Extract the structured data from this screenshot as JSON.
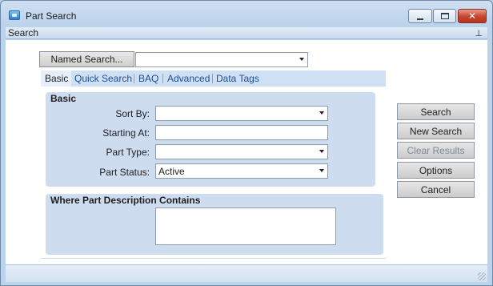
{
  "window": {
    "title": "Part Search",
    "close_glyph": "✕"
  },
  "panel": {
    "header": "Search",
    "pin_glyph": "⊥"
  },
  "named_search": {
    "button_label": "Named Search...",
    "value": ""
  },
  "tabs": [
    {
      "label": "Basic",
      "active": true
    },
    {
      "label": "Quick Search",
      "active": false
    },
    {
      "label": "BAQ",
      "active": false
    },
    {
      "label": "Advanced",
      "active": false
    },
    {
      "label": "Data Tags",
      "active": false
    }
  ],
  "basic_group": {
    "title": "Basic",
    "sort_by": {
      "label": "Sort By:",
      "value": ""
    },
    "starting_at": {
      "label": "Starting At:",
      "value": ""
    },
    "part_type": {
      "label": "Part Type:",
      "value": ""
    },
    "part_status": {
      "label": "Part Status:",
      "value": "Active"
    }
  },
  "where_group": {
    "title": "Where Part Description Contains",
    "value": ""
  },
  "actions": {
    "search": "Search",
    "new_search": "New Search",
    "clear_results": "Clear Results",
    "options": "Options",
    "cancel": "Cancel"
  },
  "icons": {
    "app": "app-window-icon",
    "minimize": "minimize-icon",
    "maximize": "maximize-icon",
    "close": "close-icon",
    "pin": "pin-icon",
    "dropdown": "chevron-down-icon"
  }
}
